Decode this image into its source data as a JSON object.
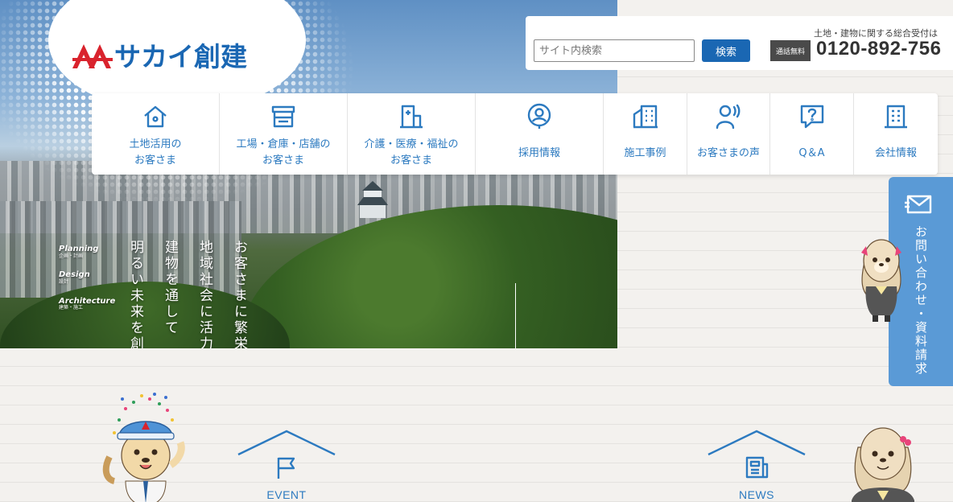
{
  "brand": {
    "logo_text": "サカイ創建",
    "color": "#1a67b3"
  },
  "hero": {
    "copy_lines": [
      "お客さまに繁栄を",
      "地域社会に活力を",
      "建物を通して",
      "明るい未来を創造"
    ],
    "service_list": [
      {
        "title": "Planning",
        "sub": "企画・計画"
      },
      {
        "title": "Design",
        "sub": "設計"
      },
      {
        "title": "Architecture",
        "sub": "建築・施工"
      }
    ]
  },
  "search": {
    "placeholder": "サイト内検索",
    "button_label": "検索"
  },
  "tel": {
    "label": "土地・建物に関する総合受付は",
    "badge": "通話無料",
    "number": "0120-892-756"
  },
  "nav": {
    "accent": "#2c7ac0",
    "items": [
      {
        "label": "土地活用の\nお客さま",
        "icon": "house-icon"
      },
      {
        "label": "工場・倉庫・店舗の\nお客さま",
        "icon": "store-icon"
      },
      {
        "label": "介護・医療・福祉の\nお客さま",
        "icon": "hospital-icon"
      },
      {
        "label": "採用情報",
        "icon": "person-circle-icon"
      },
      {
        "label": "施工事例",
        "icon": "buildings-icon"
      },
      {
        "label": "お客さまの声",
        "icon": "speaking-person-icon"
      },
      {
        "label": "Q＆A",
        "icon": "question-bubble-icon"
      },
      {
        "label": "会社情報",
        "icon": "office-building-icon"
      }
    ]
  },
  "contact_tab": {
    "label": "お問い合わせ・資料請求",
    "icon": "mail-icon",
    "color": "#5a9ad6"
  },
  "sections": {
    "event": {
      "label": "EVENT",
      "icon": "flag-icon"
    },
    "news": {
      "label": "NEWS",
      "icon": "newspaper-icon"
    }
  }
}
